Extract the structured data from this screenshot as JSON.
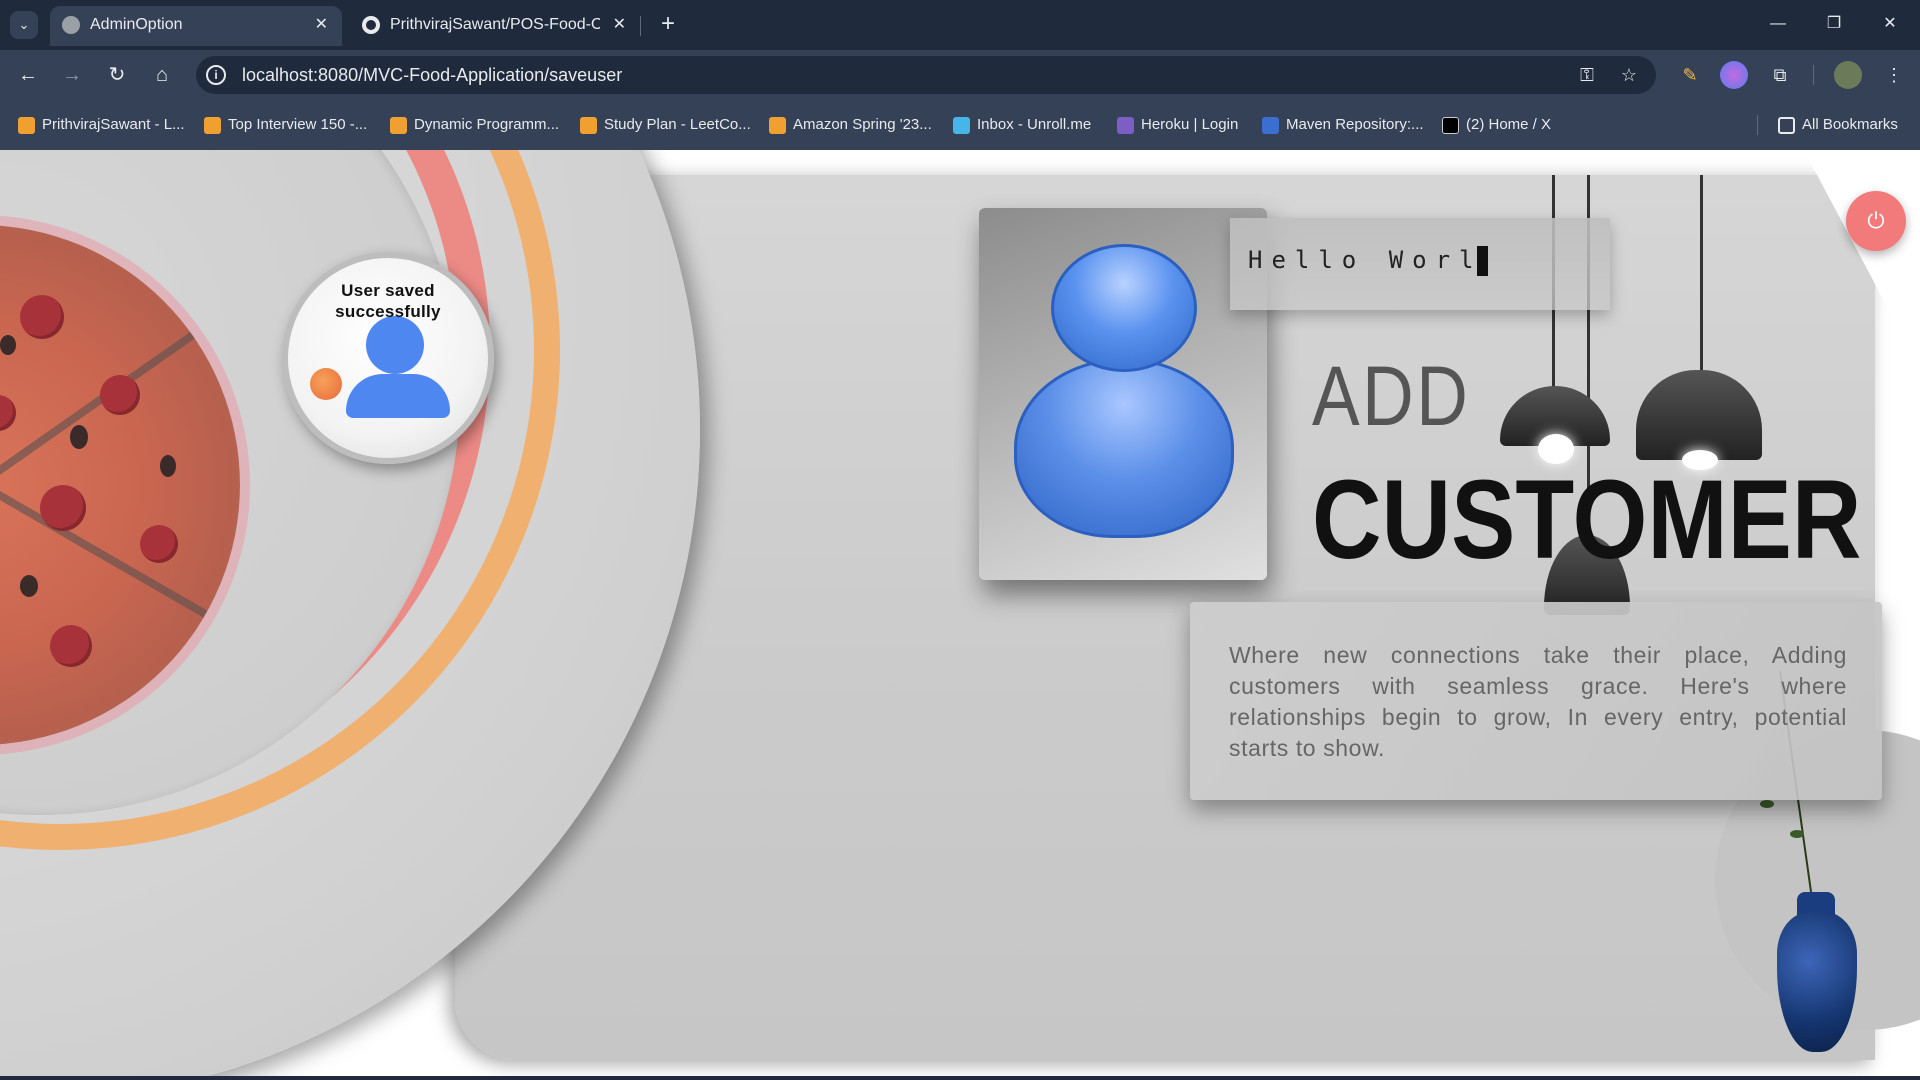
{
  "browser": {
    "tabs": [
      {
        "title": "AdminOption",
        "active": true
      },
      {
        "title": "PrithvirajSawant/POS-Food-Order",
        "active": false
      }
    ],
    "url": "localhost:8080/MVC-Food-Application/saveuser",
    "bookmarks": [
      {
        "label": "PrithvirajSawant - L...",
        "icon": "leetcode-icon"
      },
      {
        "label": "Top Interview 150 -...",
        "icon": "leetcode-icon"
      },
      {
        "label": "Dynamic Programm...",
        "icon": "leetcode-icon"
      },
      {
        "label": "Study Plan - LeetCo...",
        "icon": "leetcode-icon"
      },
      {
        "label": "Amazon Spring '23...",
        "icon": "leetcode-icon"
      },
      {
        "label": "Inbox - Unroll.me",
        "icon": "unroll-icon"
      },
      {
        "label": "Heroku | Login",
        "icon": "heroku-icon"
      },
      {
        "label": "Maven Repository:...",
        "icon": "maven-icon"
      },
      {
        "label": "(2) Home / X",
        "icon": "x-icon"
      }
    ],
    "all_bookmarks": "All Bookmarks"
  },
  "page": {
    "toast_message": "User saved successfully",
    "typed_text": "Hello Worl",
    "title_line1": "ADD",
    "title_line2": "CUSTOMER",
    "description": "Where new connections take their place, Adding customers with seamless grace. Here's where relationships begin to grow, In every entry, potential starts to show.",
    "power_icon": "power-icon"
  },
  "colors": {
    "chrome_dark": "#1f2a3c",
    "chrome_mid": "#354156",
    "power_button": "#f27a7a",
    "user_icon_blue": "#4f87f0"
  }
}
